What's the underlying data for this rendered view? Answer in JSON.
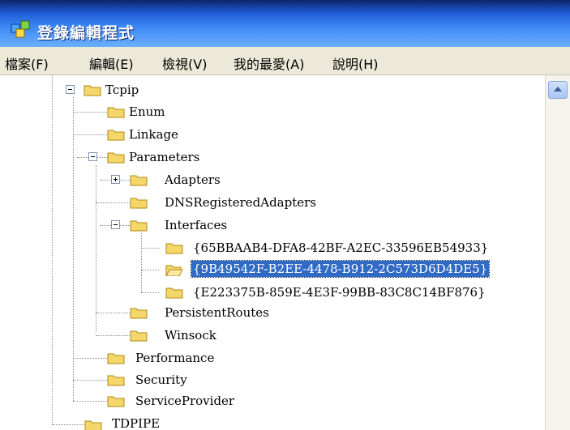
{
  "window": {
    "title": "登錄編輯程式",
    "app_icon": "registry-editor-icon"
  },
  "menu": [
    {
      "label": "檔案(F)"
    },
    {
      "label": "編輯(E)"
    },
    {
      "label": "檢視(V)"
    },
    {
      "label": "我的最愛(A)"
    },
    {
      "label": "說明(H)"
    }
  ],
  "tree": {
    "tcpip": "Tcpip",
    "enum": "Enum",
    "linkage": "Linkage",
    "parameters": "Parameters",
    "adapters": "Adapters",
    "dns_registered_adapters": "DNSRegisteredAdapters",
    "interfaces": "Interfaces",
    "interface_1": "{65BBAAB4-DFA8-42BF-A2EC-33596EB54933}",
    "interface_2": "{9B49542F-B2EE-4478-B912-2C573D6D4DE5}",
    "interface_3": "{E223375B-859E-4E3F-99BB-83C8C14BF876}",
    "persistent_routes": "PersistentRoutes",
    "winsock": "Winsock",
    "performance": "Performance",
    "security": "Security",
    "service_provider": "ServiceProvider",
    "tdpipe": "TDPIPE"
  },
  "colors": {
    "selection": "#316ac5",
    "folder": "#f5d66b",
    "titlebar": "#1f5cd6"
  }
}
